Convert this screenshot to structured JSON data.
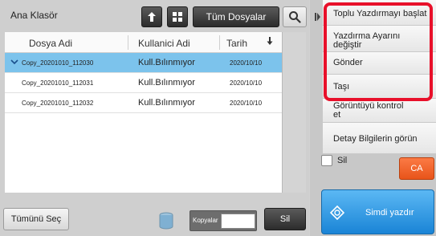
{
  "header": {
    "folder_label": "Ana Klasör",
    "up_icon": "up-arrow-icon",
    "grid_icon": "grid-view-icon",
    "all_files_label": "Tüm Dosyalar",
    "search_icon": "search-icon"
  },
  "table": {
    "columns": [
      "Dosya Adi",
      "Kullanici Adi",
      "Tarih"
    ],
    "sort_icon": "sort-down-arrow-icon",
    "rows": [
      {
        "name": "Copy_20201010_112030",
        "user": "Kull.Bılınmıyor",
        "date": "2020/10/10",
        "selected": true
      },
      {
        "name": "Copy_20201010_112031",
        "user": "Kull.Bılınmıyor",
        "date": "2020/10/10",
        "selected": false
      },
      {
        "name": "Copy_20201010_112032",
        "user": "Kull.Bılınmıyor",
        "date": "2020/10/10",
        "selected": false
      }
    ]
  },
  "bottom": {
    "select_all_label": "Tümünü Seç",
    "copies_label": "Kopyalar",
    "copies_value": "",
    "delete_label": "Sil"
  },
  "side_menu": {
    "items": [
      {
        "label": "Toplu Yazdırmayı başlat"
      },
      {
        "label": "Yazdırma Ayarını değiştir"
      },
      {
        "label": "Gönder"
      },
      {
        "label": "Taşı"
      },
      {
        "label": "Görüntüyü kontrol et"
      },
      {
        "label": "Detay Bilgilerin görün"
      }
    ]
  },
  "actions": {
    "sil_label": "Sil",
    "ca_label": "CA",
    "print_now_label": "Simdi yazdır"
  },
  "colors": {
    "selected_row": "#7cc3ec",
    "highlight": "#e8102a",
    "ca": "#f06a30",
    "print": "#2a95e2"
  }
}
